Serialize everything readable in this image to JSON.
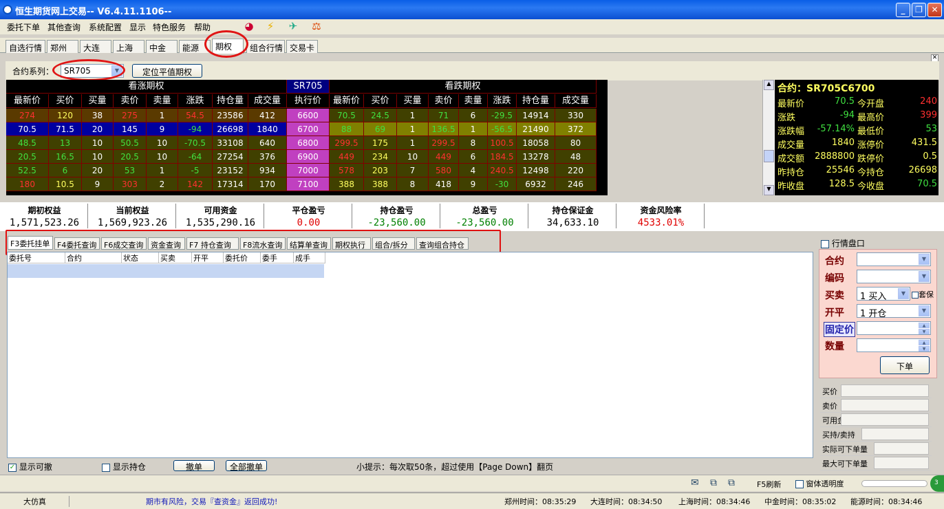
{
  "window": {
    "title": "恒生期货网上交易--  V6.4.11.1106--",
    "buttons": {
      "minimize": "_",
      "restore": "❐",
      "close": "✕"
    }
  },
  "menu": [
    "委托下单",
    "其他查询",
    "系统配置",
    "显示",
    "特色服务",
    "帮助"
  ],
  "toolbar_icons": [
    "chart-icon",
    "lightning-icon",
    "bird-icon",
    "scale-icon"
  ],
  "market_tabs": [
    "自选行情",
    "郑州",
    "大连",
    "上海",
    "中金",
    "能源",
    "期权",
    "组合行情",
    "交易卡"
  ],
  "active_market_tab": "期权",
  "contract": {
    "label": "合约系列：",
    "value": "SR705",
    "locate_button": "定位平值期权"
  },
  "quote": {
    "call_title": "看涨期权",
    "put_title": "看跌期权",
    "series_title": "SR705",
    "columns_call": [
      "最新价",
      "买价",
      "买量",
      "卖价",
      "卖量",
      "涨跌",
      "持仓量",
      "成交量"
    ],
    "strike_col": "执行价",
    "columns_put": [
      "最新价",
      "买价",
      "买量",
      "卖价",
      "卖量",
      "涨跌",
      "持仓量",
      "成交量"
    ],
    "rows": [
      {
        "call": [
          "274",
          "120",
          "38",
          "275",
          "1",
          "54.5",
          "23586",
          "412"
        ],
        "strike": "6600",
        "put": [
          "70.5",
          "24.5",
          "1",
          "71",
          "6",
          "-29.5",
          "14914",
          "330"
        ]
      },
      {
        "call": [
          "70.5",
          "71.5",
          "20",
          "145",
          "9",
          "-94",
          "26698",
          "1840"
        ],
        "strike": "6700",
        "put": [
          "88",
          "69",
          "1",
          "136.5",
          "1",
          "-56.5",
          "21490",
          "372"
        ]
      },
      {
        "call": [
          "48.5",
          "13",
          "10",
          "50.5",
          "10",
          "-70.5",
          "33108",
          "640"
        ],
        "strike": "6800",
        "put": [
          "299.5",
          "175",
          "1",
          "299.5",
          "8",
          "100.5",
          "18058",
          "80"
        ]
      },
      {
        "call": [
          "20.5",
          "16.5",
          "10",
          "20.5",
          "10",
          "-64",
          "27254",
          "376"
        ],
        "strike": "6900",
        "put": [
          "449",
          "234",
          "10",
          "449",
          "6",
          "184.5",
          "13278",
          "48"
        ]
      },
      {
        "call": [
          "52.5",
          "6",
          "20",
          "53",
          "1",
          "-5",
          "23152",
          "934"
        ],
        "strike": "7000",
        "put": [
          "578",
          "203",
          "7",
          "580",
          "4",
          "240.5",
          "12498",
          "220"
        ]
      },
      {
        "call": [
          "180",
          "10.5",
          "9",
          "303",
          "2",
          "142",
          "17314",
          "170"
        ],
        "strike": "7100",
        "put": [
          "388",
          "388",
          "8",
          "418",
          "9",
          "-30",
          "6932",
          "246"
        ]
      }
    ]
  },
  "info": {
    "title": "合约：SR705C6700",
    "rows": [
      {
        "l1": "最新价",
        "v1": "70.5",
        "l2": "今开盘",
        "v2": "240",
        "c1": "#40e040",
        "c2": "#ff3030"
      },
      {
        "l1": "涨跌",
        "v1": "-94",
        "l2": "最高价",
        "v2": "399",
        "c1": "#40e040",
        "c2": "#ff3030"
      },
      {
        "l1": "涨跌幅",
        "v1": "-57.14%",
        "l2": "最低价",
        "v2": "53",
        "c1": "#40e040",
        "c2": "#40e040"
      },
      {
        "l1": "成交量",
        "v1": "1840",
        "l2": "涨停价",
        "v2": "431.5",
        "c1": "#ffff60",
        "c2": "#ffff60"
      },
      {
        "l1": "成交额",
        "v1": "2888800",
        "l2": "跌停价",
        "v2": "0.5",
        "c1": "#ffff60",
        "c2": "#ffff60"
      },
      {
        "l1": "昨持仓",
        "v1": "25546",
        "l2": "今持仓",
        "v2": "26698",
        "c1": "#ffff60",
        "c2": "#ffff60"
      },
      {
        "l1": "昨收盘",
        "v1": "128.5",
        "l2": "今收盘",
        "v2": "70.5",
        "c1": "#ffff60",
        "c2": "#40e040"
      }
    ]
  },
  "account": [
    {
      "label": "期初权益",
      "value": "1,571,523.26",
      "color": "#000000"
    },
    {
      "label": "当前权益",
      "value": "1,569,923.26",
      "color": "#000000"
    },
    {
      "label": "可用资金",
      "value": "1,535,290.16",
      "color": "#000000"
    },
    {
      "label": "平仓盈亏",
      "value": "0.00",
      "color": "#e00000"
    },
    {
      "label": "持仓盈亏",
      "value": "-23,560.00",
      "color": "#008000"
    },
    {
      "label": "总盈亏",
      "value": "-23,560.00",
      "color": "#008000"
    },
    {
      "label": "持仓保证金",
      "value": "34,633.10",
      "color": "#000000"
    },
    {
      "label": "资金风险率",
      "value": "4533.01%",
      "color": "#e00000"
    }
  ],
  "order_tabs": [
    "F3委托挂单",
    "F4委托查询",
    "F6成交查询",
    "资金查询",
    "F7 持仓查询",
    "F8流水查询",
    "结算单查询",
    "期权执行",
    "组合/拆分",
    "查询组合持仓"
  ],
  "order_columns": [
    "委托号",
    "合约",
    "状态",
    "买卖",
    "开平",
    "委托价",
    "委手",
    "成手"
  ],
  "bottom_controls": {
    "show_cancelable": "显示可撤",
    "show_positions": "显示持仓",
    "cancel": "撤单",
    "cancel_all": "全部撤单",
    "hint": "小提示：每次取50条，超过使用【Page Down】翻页"
  },
  "order_panel": {
    "quote_board": "行情盘口",
    "contract_label": "合约",
    "code_label": "编码",
    "side_label": "买卖",
    "side_value": "1  买入",
    "hedge_label": "套保",
    "offset_label": "开平",
    "offset_value": "1  开仓",
    "price_label": "固定价",
    "qty_label": "数量",
    "submit": "下单",
    "info_labels": [
      "买价",
      "卖价",
      "可用金",
      "买持/卖持",
      "实际可下单量",
      "最大可下单量"
    ]
  },
  "toolrow": {
    "refresh": "F5刷新",
    "transparency": "窗体透明度"
  },
  "status": {
    "mode": "大仿真",
    "message": "期市有风险，交易『查资金』返回成功!",
    "times": [
      "郑州时间：08:35:29",
      "大连时间：08:34:50",
      "上海时间：08:34:46",
      "中金时间：08:35:02",
      "能源时间：08:34:46"
    ]
  }
}
